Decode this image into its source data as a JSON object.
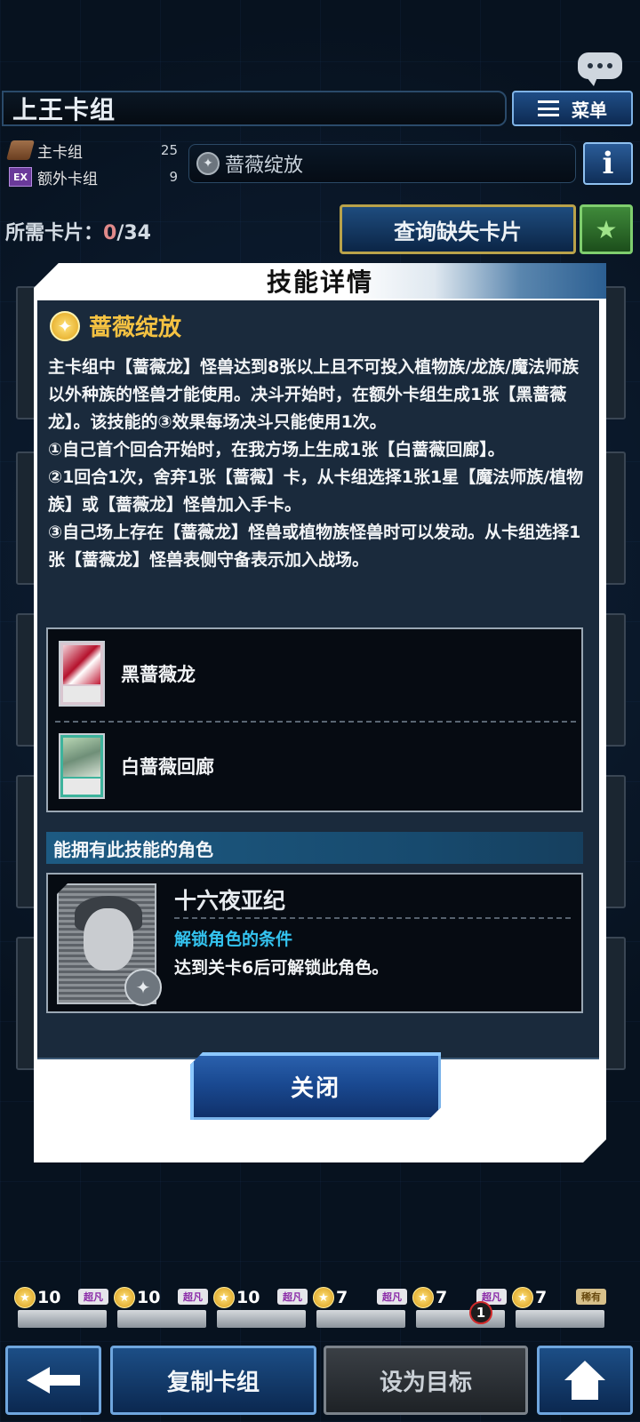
{
  "header": {
    "deck_name": "上王卡组",
    "menu_label": "菜单",
    "chat_icon": "chat-bubble-icon",
    "info_icon": "info-icon",
    "info_label": "i"
  },
  "deck_counts": {
    "main_label": "主卡组",
    "main_count": "25",
    "extra_badge": "EX",
    "extra_label": "额外卡组",
    "extra_count": "9"
  },
  "skill_slot": {
    "name": "蔷薇绽放"
  },
  "required": {
    "label": "所需卡片：",
    "owned": "0",
    "total": "/34"
  },
  "query_button": "查询缺失卡片",
  "modal": {
    "title": "技能详情",
    "skill_name": "蔷薇绽放",
    "description": "主卡组中【蔷薇龙】怪兽达到8张以上且不可投入植物族/龙族/魔法师族以外种族的怪兽才能使用。决斗开始时，在额外卡组生成1张【黑蔷薇龙】。该技能的③效果每场决斗只能使用1次。\n①自己首个回合开始时，在我方场上生成1张【白蔷薇回廊】。\n②1回合1次，舍弃1张【蔷薇】卡，从卡组选择1张1星【魔法师族/植物族】或【蔷薇龙】怪兽加入手卡。\n③自己场上存在【蔷薇龙】怪兽或植物族怪兽时可以发动。从卡组选择1张【蔷薇龙】怪兽表侧守备表示加入战场。",
    "related_cards": [
      {
        "name": "黑蔷薇龙"
      },
      {
        "name": "白蔷薇回廊"
      }
    ],
    "owners_header": "能拥有此技能的角色",
    "owner": {
      "name": "十六夜亚纪",
      "condition_title": "解锁角色的条件",
      "condition": "达到关卡6后可解锁此角色。"
    },
    "close_label": "关闭"
  },
  "bottom_strip": [
    {
      "level": "10",
      "tag": "超凡"
    },
    {
      "level": "10",
      "tag": "超凡"
    },
    {
      "level": "10",
      "tag": "超凡"
    },
    {
      "level": "7",
      "tag": "超凡"
    },
    {
      "level": "7",
      "tag": "超凡",
      "count": "1"
    },
    {
      "level": "7",
      "tag": "稀有"
    }
  ],
  "nav": {
    "copy_label": "复制卡组",
    "target_label": "设为目标"
  }
}
